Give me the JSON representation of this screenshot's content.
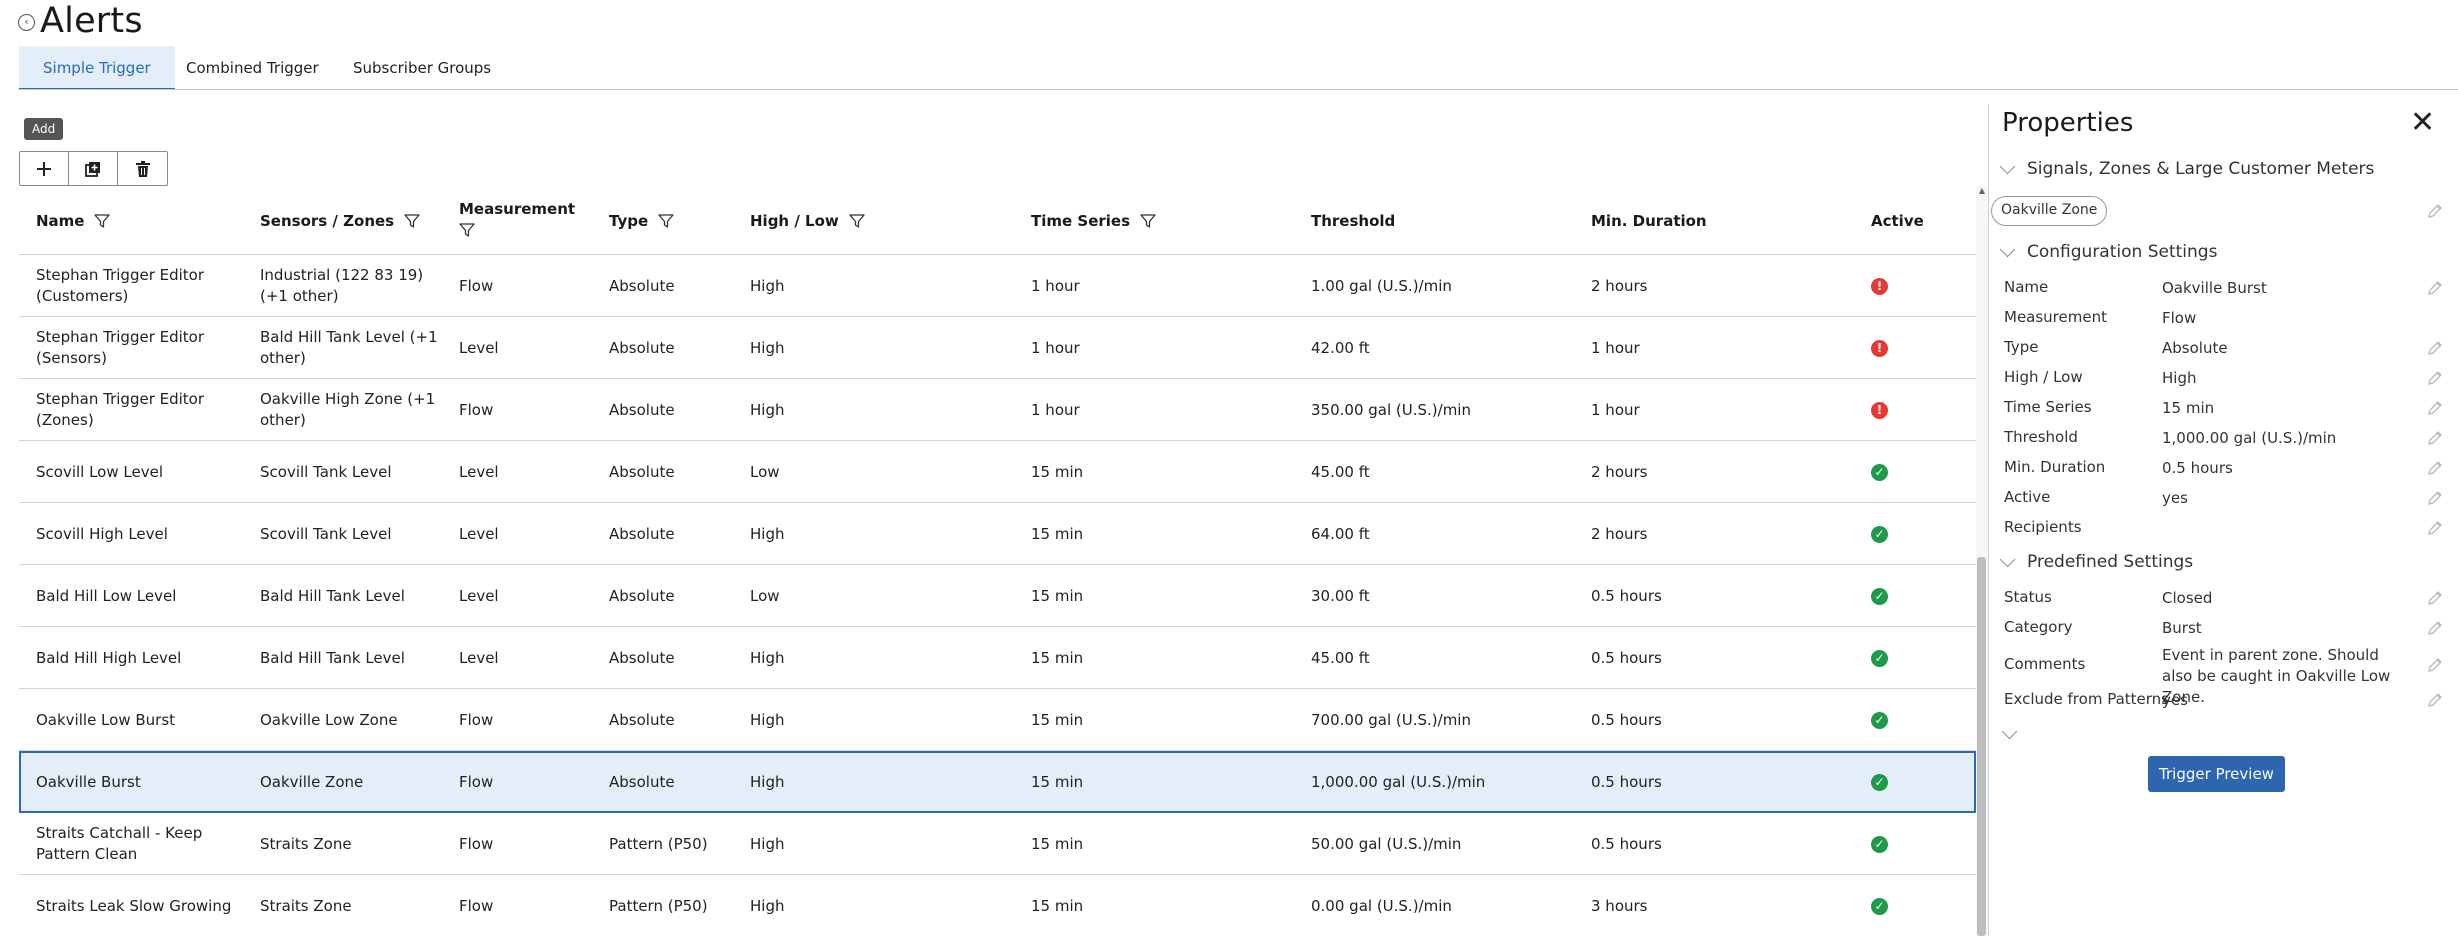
{
  "header": {
    "title": "Alerts",
    "back_icon": "‹"
  },
  "tabs": [
    {
      "label": "Simple Trigger",
      "active": true
    },
    {
      "label": "Combined Trigger",
      "active": false
    },
    {
      "label": "Subscriber Groups",
      "active": false
    }
  ],
  "toolbar": {
    "tooltip": "Add",
    "add_icon": "plus-icon",
    "duplicate_icon": "duplicate-icon",
    "delete_icon": "trash-icon"
  },
  "table": {
    "columns": [
      {
        "label": "Name",
        "filter": true
      },
      {
        "label": "Sensors / Zones",
        "filter": true
      },
      {
        "label": "Measurement",
        "filter": true
      },
      {
        "label": "Type",
        "filter": true
      },
      {
        "label": "High / Low",
        "filter": true
      },
      {
        "label": "Time Series",
        "filter": true
      },
      {
        "label": "Threshold",
        "filter": false
      },
      {
        "label": "Min. Duration",
        "filter": false
      },
      {
        "label": "Active",
        "filter": false
      }
    ],
    "rows": [
      {
        "name": "Stephan Trigger Editor (Customers)",
        "sensors": "Industrial (122 83 19) (+1 other)",
        "measurement": "Flow",
        "type": "Absolute",
        "highlow": "High",
        "timeseries": "1 hour",
        "threshold": "1.00 gal (U.S.)/min",
        "duration": "2 hours",
        "active": "error",
        "selected": false
      },
      {
        "name": "Stephan Trigger Editor (Sensors)",
        "sensors": "Bald Hill Tank Level (+1 other)",
        "measurement": "Level",
        "type": "Absolute",
        "highlow": "High",
        "timeseries": "1 hour",
        "threshold": "42.00 ft",
        "duration": "1 hour",
        "active": "error",
        "selected": false
      },
      {
        "name": "Stephan Trigger Editor (Zones)",
        "sensors": "Oakville High Zone (+1 other)",
        "measurement": "Flow",
        "type": "Absolute",
        "highlow": "High",
        "timeseries": "1 hour",
        "threshold": "350.00 gal (U.S.)/min",
        "duration": "1 hour",
        "active": "error",
        "selected": false
      },
      {
        "name": "Scovill Low Level",
        "sensors": "Scovill Tank Level",
        "measurement": "Level",
        "type": "Absolute",
        "highlow": "Low",
        "timeseries": "15 min",
        "threshold": "45.00 ft",
        "duration": "2 hours",
        "active": "ok",
        "selected": false
      },
      {
        "name": "Scovill High Level",
        "sensors": "Scovill Tank Level",
        "measurement": "Level",
        "type": "Absolute",
        "highlow": "High",
        "timeseries": "15 min",
        "threshold": "64.00 ft",
        "duration": "2 hours",
        "active": "ok",
        "selected": false
      },
      {
        "name": "Bald Hill Low Level",
        "sensors": "Bald Hill Tank Level",
        "measurement": "Level",
        "type": "Absolute",
        "highlow": "Low",
        "timeseries": "15 min",
        "threshold": "30.00 ft",
        "duration": "0.5 hours",
        "active": "ok",
        "selected": false
      },
      {
        "name": "Bald Hill High Level",
        "sensors": "Bald Hill Tank Level",
        "measurement": "Level",
        "type": "Absolute",
        "highlow": "High",
        "timeseries": "15 min",
        "threshold": "45.00 ft",
        "duration": "0.5 hours",
        "active": "ok",
        "selected": false
      },
      {
        "name": "Oakville Low Burst",
        "sensors": "Oakville Low Zone",
        "measurement": "Flow",
        "type": "Absolute",
        "highlow": "High",
        "timeseries": "15 min",
        "threshold": "700.00 gal (U.S.)/min",
        "duration": "0.5 hours",
        "active": "ok",
        "selected": false
      },
      {
        "name": "Oakville Burst",
        "sensors": "Oakville Zone",
        "measurement": "Flow",
        "type": "Absolute",
        "highlow": "High",
        "timeseries": "15 min",
        "threshold": "1,000.00 gal (U.S.)/min",
        "duration": "0.5 hours",
        "active": "ok",
        "selected": true
      },
      {
        "name": "Straits Catchall - Keep Pattern Clean",
        "sensors": "Straits Zone",
        "measurement": "Flow",
        "type": "Pattern (P50)",
        "highlow": "High",
        "timeseries": "15 min",
        "threshold": "50.00 gal (U.S.)/min",
        "duration": "0.5 hours",
        "active": "ok",
        "selected": false
      },
      {
        "name": "Straits Leak Slow Growing",
        "sensors": "Straits Zone",
        "measurement": "Flow",
        "type": "Pattern (P50)",
        "highlow": "High",
        "timeseries": "15 min",
        "threshold": "0.00 gal (U.S.)/min",
        "duration": "3 hours",
        "active": "ok",
        "selected": false
      }
    ]
  },
  "properties": {
    "title": "Properties",
    "close_icon": "✕",
    "signals_section": "Signals, Zones & Large Customer Meters",
    "zone_pill": "Oakville Zone",
    "config_section": "Configuration Settings",
    "config": [
      {
        "label": "Name",
        "value": "Oakville Burst"
      },
      {
        "label": "Measurement",
        "value": "Flow"
      },
      {
        "label": "Type",
        "value": "Absolute"
      },
      {
        "label": "High / Low",
        "value": "High"
      },
      {
        "label": "Time Series",
        "value": "15 min"
      },
      {
        "label": "Threshold",
        "value": "1,000.00 gal (U.S.)/min"
      },
      {
        "label": "Min. Duration",
        "value": "0.5 hours"
      },
      {
        "label": "Active",
        "value": "yes"
      },
      {
        "label": "Recipients",
        "value": ""
      }
    ],
    "predefined_section": "Predefined Settings",
    "predefined": [
      {
        "label": "Status",
        "value": "Closed"
      },
      {
        "label": "Category",
        "value": "Burst"
      },
      {
        "label": "Comments",
        "value": "Event in parent zone. Should also be caught in Oakville Low Zone."
      },
      {
        "label": "Exclude from Patterns",
        "value": "yes"
      }
    ],
    "trigger_preview": "Trigger Preview"
  },
  "colors": {
    "accent": "#2a6ab8",
    "selected_bg": "#e4eef8",
    "ok": "#1f9a4a",
    "error": "#e53935",
    "button": "#2d65b0"
  }
}
